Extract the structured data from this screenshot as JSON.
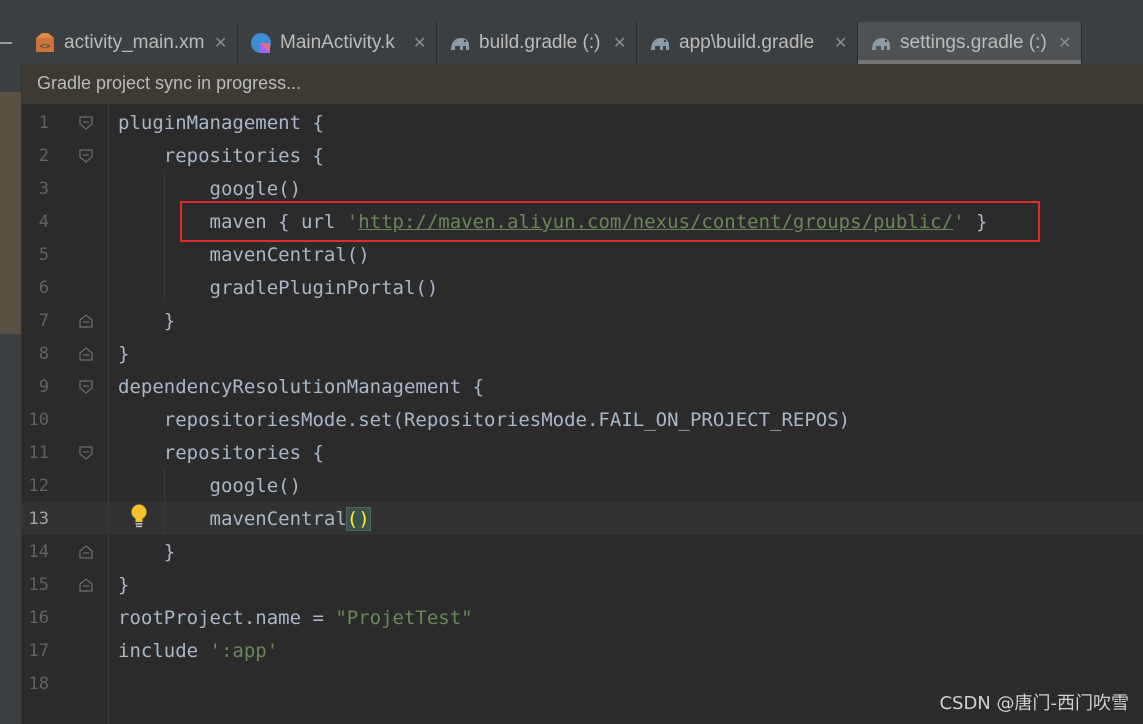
{
  "tabs": [
    {
      "label": "activity_main.xm",
      "icon": "xml-file-icon",
      "active": false
    },
    {
      "label": "MainActivity.k",
      "icon": "kotlin-file-icon",
      "active": false
    },
    {
      "label": "build.gradle (:)",
      "icon": "gradle-elephant-icon",
      "active": false
    },
    {
      "label": "app\\build.gradle",
      "icon": "gradle-elephant-icon",
      "active": false
    },
    {
      "label": "settings.gradle (:)",
      "icon": "gradle-elephant-icon",
      "active": true
    }
  ],
  "close_glyph": "✕",
  "notification": "Gradle project sync in progress...",
  "current_line": 13,
  "lines": [
    {
      "n": "1",
      "segments": [
        {
          "t": "pluginManagement {"
        }
      ]
    },
    {
      "n": "2",
      "segments": [
        {
          "t": "    repositories {"
        }
      ]
    },
    {
      "n": "3",
      "segments": [
        {
          "t": "        google()"
        }
      ]
    },
    {
      "n": "4",
      "segments": [
        {
          "t": "        maven { url "
        },
        {
          "t": "'",
          "c": "str"
        },
        {
          "t": "http://maven.aliyun.com/nexus/content/groups/public/",
          "c": "url"
        },
        {
          "t": "'",
          "c": "str"
        },
        {
          "t": " }"
        }
      ]
    },
    {
      "n": "5",
      "segments": [
        {
          "t": "        mavenCentral()"
        }
      ]
    },
    {
      "n": "6",
      "segments": [
        {
          "t": "        gradlePluginPortal()"
        }
      ]
    },
    {
      "n": "7",
      "segments": [
        {
          "t": "    }"
        }
      ]
    },
    {
      "n": "8",
      "segments": [
        {
          "t": "}"
        }
      ]
    },
    {
      "n": "9",
      "segments": [
        {
          "t": "dependencyResolutionManagement {"
        }
      ]
    },
    {
      "n": "10",
      "segments": [
        {
          "t": "    repositoriesMode.set(RepositoriesMode.FAIL_ON_PROJECT_REPOS)"
        }
      ]
    },
    {
      "n": "11",
      "segments": [
        {
          "t": "    repositories {"
        }
      ]
    },
    {
      "n": "12",
      "segments": [
        {
          "t": "        google()"
        }
      ]
    },
    {
      "n": "13",
      "segments": [
        {
          "t": "        mavenCentral"
        },
        {
          "t": "()",
          "c": "brace-match"
        }
      ]
    },
    {
      "n": "14",
      "segments": [
        {
          "t": "    }"
        }
      ]
    },
    {
      "n": "15",
      "segments": [
        {
          "t": "}"
        }
      ]
    },
    {
      "n": "16",
      "segments": [
        {
          "t": "rootProject.name = "
        },
        {
          "t": "\"ProjetTest\"",
          "c": "str"
        }
      ]
    },
    {
      "n": "17",
      "segments": [
        {
          "t": "include "
        },
        {
          "t": "':app'",
          "c": "str"
        }
      ]
    },
    {
      "n": "18",
      "segments": []
    }
  ],
  "watermark": "CSDN @唐门-西门吹雪",
  "colors": {
    "highlight_box": "#e32b2b",
    "string": "#6a8759",
    "code_text": "#a9b7c6",
    "line_number": "#606366"
  }
}
